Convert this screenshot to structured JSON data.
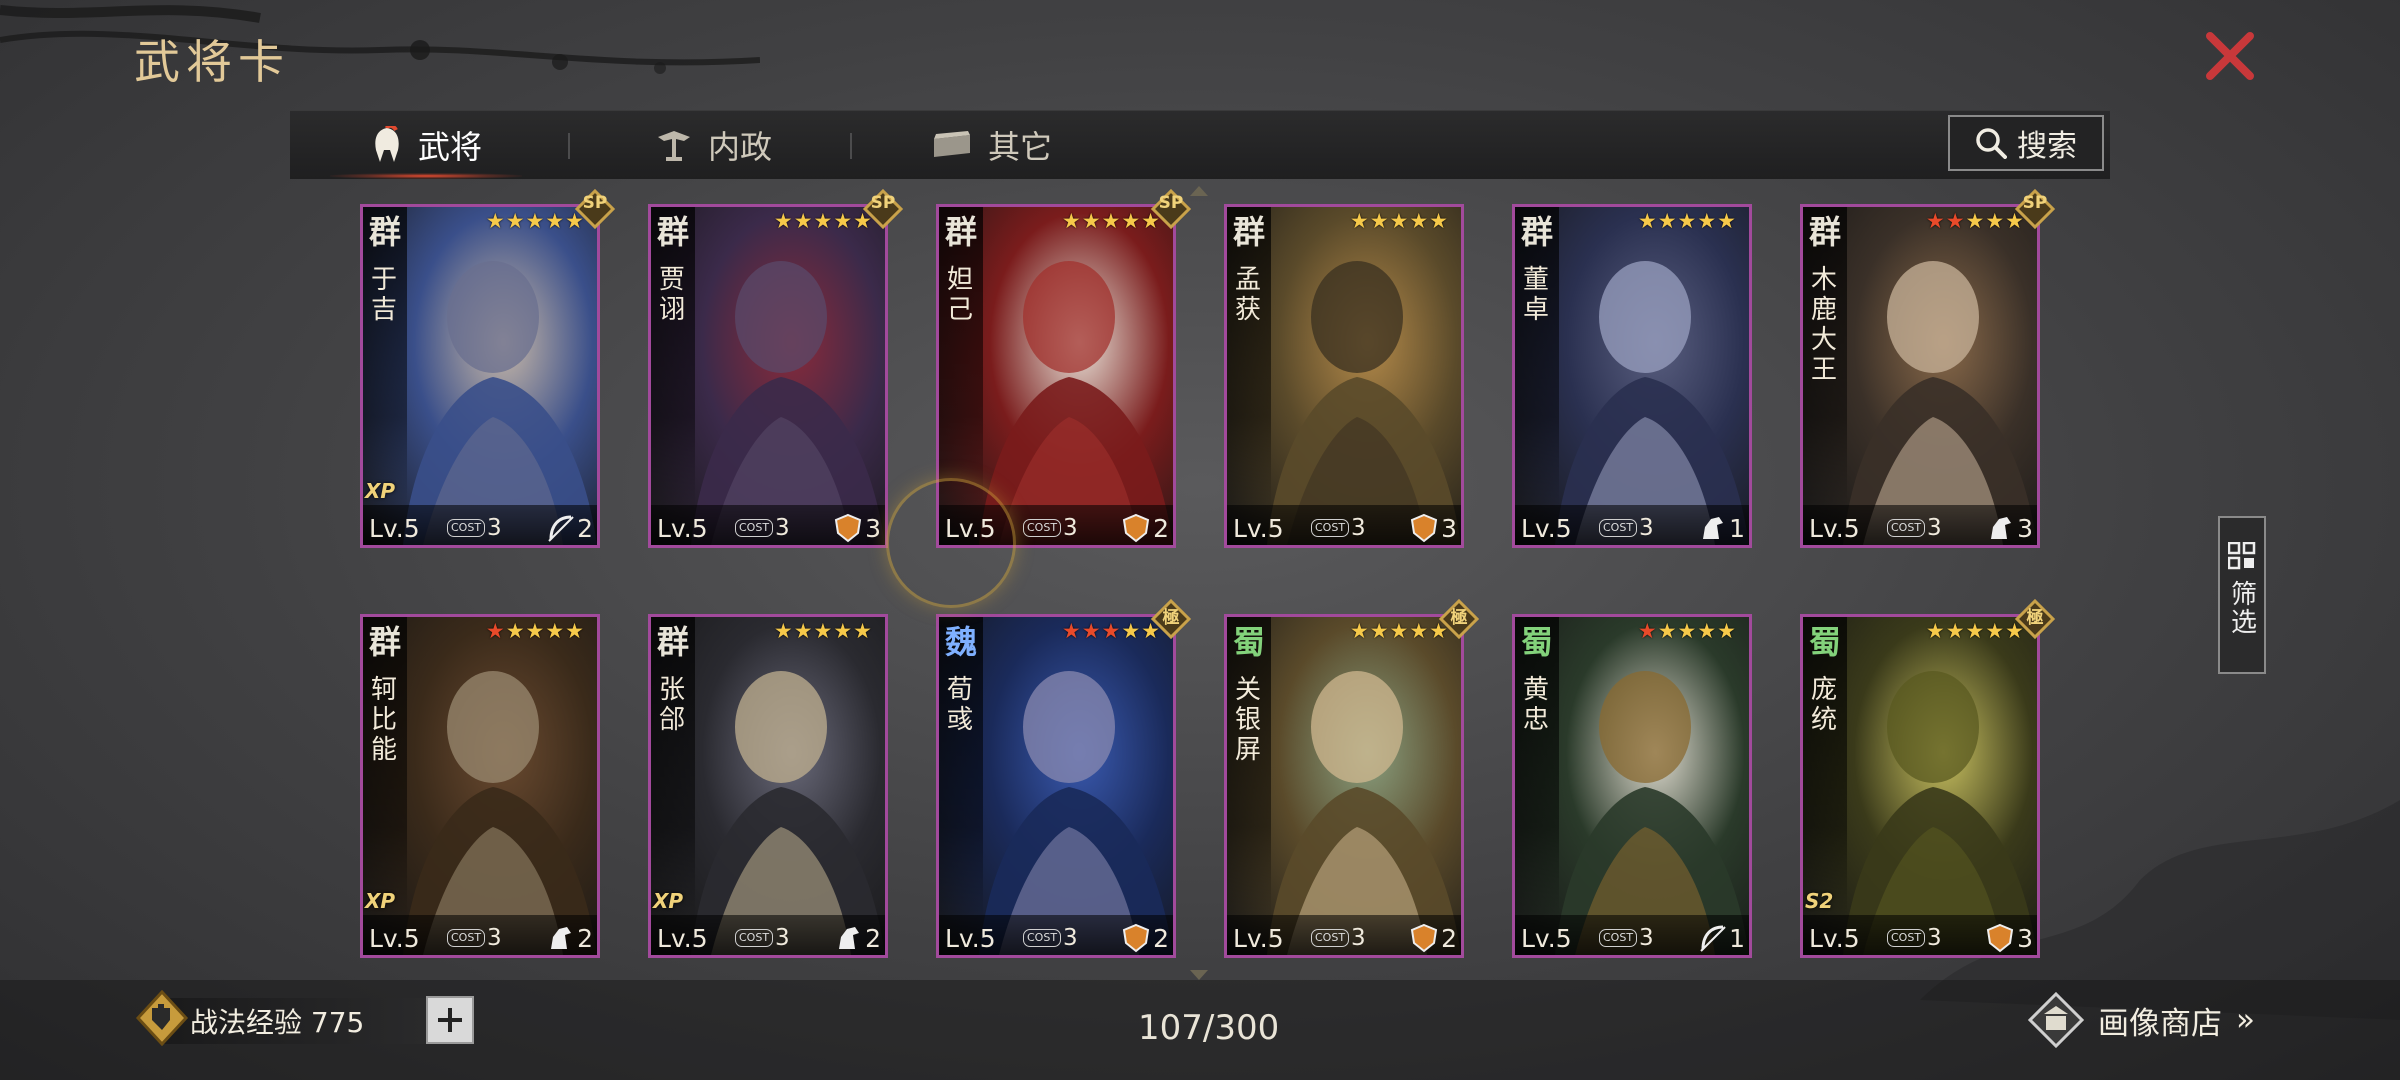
{
  "header": {
    "title": "武将卡"
  },
  "tabs": [
    {
      "label": "武将",
      "icon": "helmet-icon",
      "active": true
    },
    {
      "label": "内政",
      "icon": "ornament-icon",
      "active": false
    },
    {
      "label": "其它",
      "icon": "chest-icon",
      "active": false
    }
  ],
  "search": {
    "label": "搜索"
  },
  "filter": {
    "label": "筛选"
  },
  "cards": [
    {
      "faction": "群",
      "name": "于吉",
      "stars": 5,
      "red_stars": 0,
      "level": "Lv.5",
      "cost": "3",
      "unit_count": "2",
      "unit_icon": "bow-icon",
      "season": "XP",
      "badge": "SP"
    },
    {
      "faction": "群",
      "name": "贾诩",
      "stars": 5,
      "red_stars": 0,
      "level": "Lv.5",
      "cost": "3",
      "unit_count": "3",
      "unit_icon": "shield-icon",
      "season": "",
      "badge": "SP"
    },
    {
      "faction": "群",
      "name": "妲己",
      "stars": 5,
      "red_stars": 0,
      "level": "Lv.5",
      "cost": "3",
      "unit_count": "2",
      "unit_icon": "shield-icon",
      "season": "",
      "badge": "SP"
    },
    {
      "faction": "群",
      "name": "孟获",
      "stars": 5,
      "red_stars": 0,
      "level": "Lv.5",
      "cost": "3",
      "unit_count": "3",
      "unit_icon": "shield-icon",
      "season": "",
      "badge": ""
    },
    {
      "faction": "群",
      "name": "董卓",
      "stars": 5,
      "red_stars": 0,
      "level": "Lv.5",
      "cost": "3",
      "unit_count": "1",
      "unit_icon": "horse-icon",
      "season": "",
      "badge": ""
    },
    {
      "faction": "群",
      "name": "木鹿大王",
      "stars": 5,
      "red_stars": 2,
      "level": "Lv.5",
      "cost": "3",
      "unit_count": "3",
      "unit_icon": "horse-icon",
      "season": "",
      "badge": "SP"
    },
    {
      "faction": "群",
      "name": "轲比能",
      "stars": 5,
      "red_stars": 1,
      "level": "Lv.5",
      "cost": "3",
      "unit_count": "2",
      "unit_icon": "horse-icon",
      "season": "XP",
      "badge": ""
    },
    {
      "faction": "群",
      "name": "张郃",
      "stars": 5,
      "red_stars": 0,
      "level": "Lv.5",
      "cost": "3",
      "unit_count": "2",
      "unit_icon": "horse-icon",
      "season": "XP",
      "badge": ""
    },
    {
      "faction": "魏",
      "name": "荀彧",
      "stars": 5,
      "red_stars": 3,
      "level": "Lv.5",
      "cost": "3",
      "unit_count": "2",
      "unit_icon": "shield-icon",
      "season": "",
      "badge": "極"
    },
    {
      "faction": "蜀",
      "name": "关银屏",
      "stars": 5,
      "red_stars": 0,
      "level": "Lv.5",
      "cost": "3",
      "unit_count": "2",
      "unit_icon": "shield-icon",
      "season": "",
      "badge": "極"
    },
    {
      "faction": "蜀",
      "name": "黄忠",
      "stars": 5,
      "red_stars": 1,
      "level": "Lv.5",
      "cost": "3",
      "unit_count": "1",
      "unit_icon": "bow-icon",
      "season": "",
      "badge": ""
    },
    {
      "faction": "蜀",
      "name": "庞统",
      "stars": 5,
      "red_stars": 0,
      "level": "Lv.5",
      "cost": "3",
      "unit_count": "3",
      "unit_icon": "shield-icon",
      "season": "S2",
      "badge": "極"
    }
  ],
  "cost_label": "COST",
  "footer": {
    "exp_label": "战法经验 775",
    "count": "107/300",
    "shop_label": "画像商店",
    "shop_arrow": "»"
  },
  "colors": {
    "card_border": "#a24a9c",
    "star_gold": "#f6c94a",
    "star_red": "#e94a2a",
    "close_red": "#c8383a",
    "title_gold": "#e2c998"
  }
}
